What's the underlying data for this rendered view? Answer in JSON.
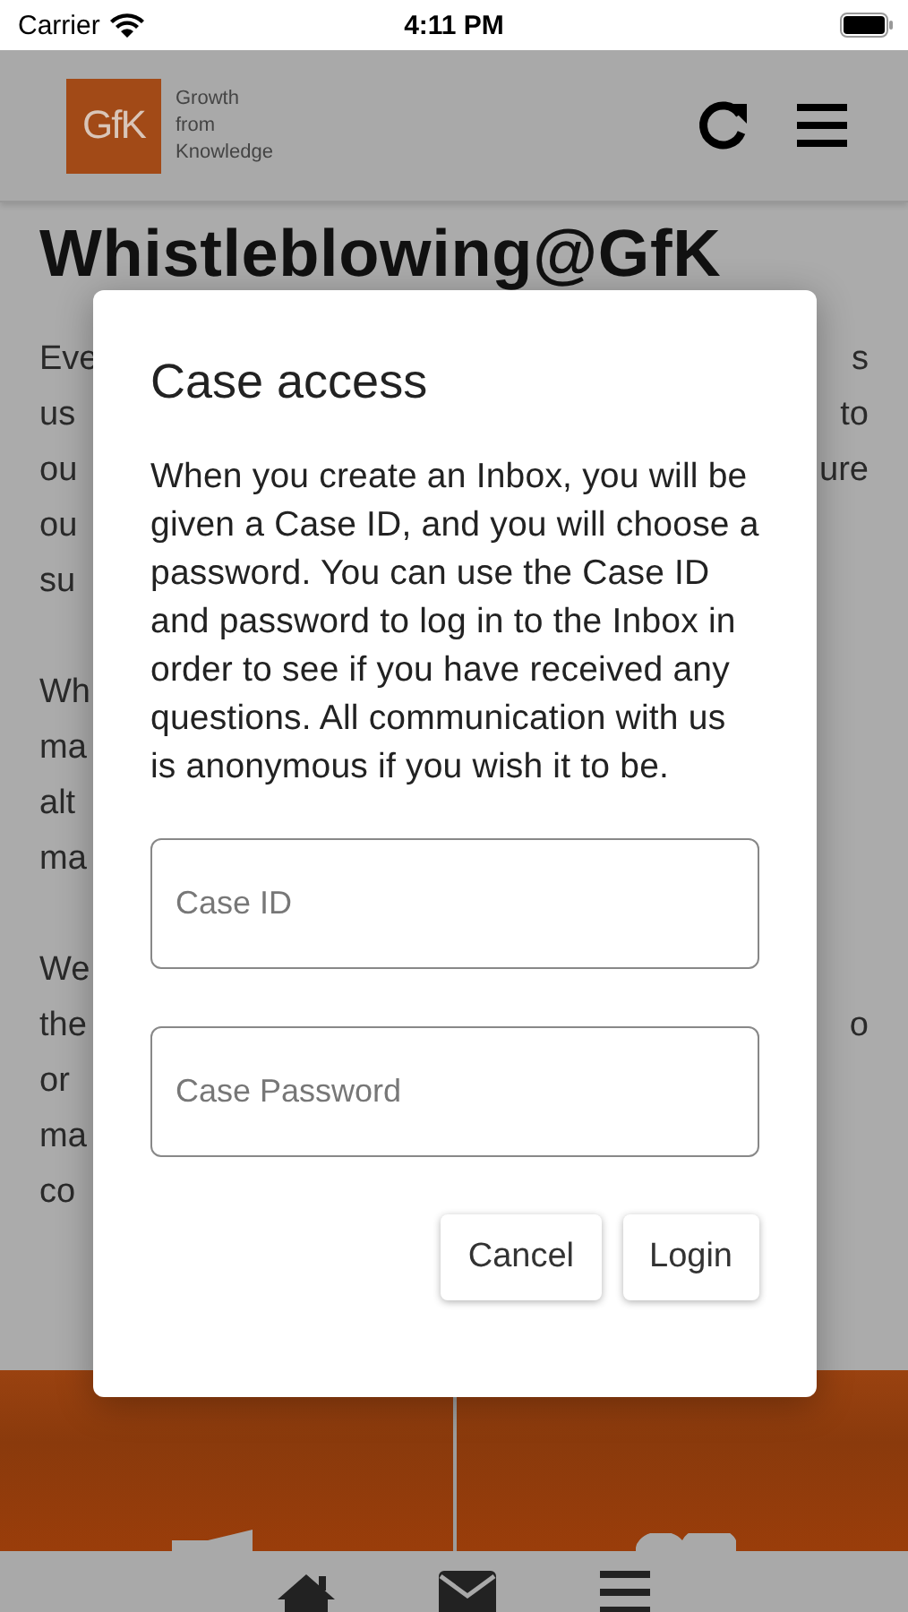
{
  "status_bar": {
    "carrier": "Carrier",
    "time": "4:11 PM"
  },
  "header": {
    "logo": {
      "mark": "GfK",
      "tagline": [
        "Growth",
        "from",
        "Knowledge"
      ]
    }
  },
  "page": {
    "title": "Whistleblowing@GfK",
    "paragraphs": [
      [
        {
          "left": "Eve",
          "right": "s"
        },
        {
          "left": "us",
          "right": "to"
        },
        {
          "left": "ou",
          "right": "ure"
        },
        {
          "left": "ou"
        },
        {
          "left": "su"
        }
      ],
      [
        {
          "left": "Wh"
        },
        {
          "left": "ma"
        },
        {
          "left": "alt"
        },
        {
          "left": "ma"
        }
      ],
      [
        {
          "left": "We"
        },
        {
          "left": "the",
          "right": "o"
        },
        {
          "left": "or"
        },
        {
          "left": "ma"
        },
        {
          "left": "co"
        }
      ]
    ]
  },
  "dialog": {
    "title": "Case access",
    "message": "When you create an Inbox, you will be given a Case ID, and you will choose a password. You can use the Case ID and password to log in to the Inbox in order to see if you have received any questions. All communication with us is anonymous if you wish it to be.",
    "fields": [
      {
        "placeholder": "Case ID"
      },
      {
        "placeholder": "Case Password"
      }
    ],
    "buttons": [
      "Cancel",
      "Login"
    ]
  }
}
